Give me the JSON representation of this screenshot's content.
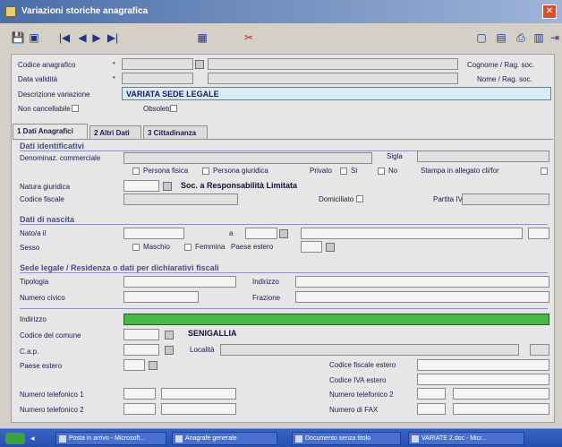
{
  "window": {
    "title": "Variazioni storiche anagrafica"
  },
  "toolbar": {
    "save": "💾",
    "first": "|◀",
    "prev": "◀",
    "next": "▶",
    "last": "▶|"
  },
  "header": {
    "codice_anagrafico_label": "Codice anagrafico",
    "data_validita_label": "Data validità",
    "descrizione_variazione_label": "Descrizione variazione",
    "descrizione_variazione_value": "VARIATA SEDE LEGALE",
    "non_cancellabile_label": "Non cancellabile",
    "obsoleto_label": "Obsoleto",
    "cognome_label": "Cognome / Rag. soc.",
    "nome_label": "Nome / Rag. soc."
  },
  "tabs": [
    {
      "label": "1 Dati Anagrafici"
    },
    {
      "label": "2 Altri Dati"
    },
    {
      "label": "3 Cittadinanza"
    }
  ],
  "dati_identificativi": {
    "section": "Dati identificativi",
    "denominaz_label": "Denominaz. commerciale",
    "sigla_label": "Sigla",
    "persona_fisica": "Persona fisica",
    "persona_giuridica": "Persona giuridica",
    "privato": "Privato",
    "si": "Sì",
    "no": "No",
    "stampa": "Stampa in allegato cli/for",
    "natura_giuridica_label": "Natura giuridica",
    "natura_giuridica_value": "Soc. a Responsabilità Limitata",
    "codice_fiscale_label": "Codice fiscale",
    "domiciliato_label": "Domiciliato",
    "partita_iva_label": "Partita IVA"
  },
  "dati_nascita": {
    "section": "Dati di nascita",
    "nato_label": "Nato/a il",
    "a_label": "a",
    "sesso_label": "Sesso",
    "maschio": "Maschio",
    "femmina": "Femmina",
    "paese_estero": "Paese estero"
  },
  "sede_legale": {
    "section": "Sede legale / Residenza o dati per dichiarativi fiscali",
    "tipologia_label": "Tipologia",
    "indirizzo_label": "Indirizzo",
    "numero_civico_label": "Numero civico",
    "frazione_label": "Frazione"
  },
  "residenza": {
    "indirizzo_label": "Indirizzo",
    "codice_comune_label": "Codice del comune",
    "comune_value": "SENIGALLIA",
    "cap_label": "C.a.p.",
    "localita_label": "Località",
    "paese_estero_label": "Paese estero",
    "codice_fiscale_estero_label": "Codice fiscale estero",
    "codice_iva_estero_label": "Codice IVA estero",
    "tel1_label": "Numero telefonico 1",
    "tel2_label": "Numero telefonico 2",
    "tel2b_label": "Numero telefonico 2",
    "fax_label": "Numero di FAX"
  },
  "taskbar": {
    "items": [
      {
        "label": "Posta in arrivo - Microsoft..."
      },
      {
        "label": "Anagrafe generale"
      },
      {
        "label": "Documento senza titolo"
      },
      {
        "label": "VARIATE 2.doc - Micr..."
      }
    ]
  },
  "colors": {
    "title_bar": "#4a6ea8",
    "taskbar": "#2850b0",
    "section_text": "#4a4a9a",
    "green_field": "#48b848"
  }
}
